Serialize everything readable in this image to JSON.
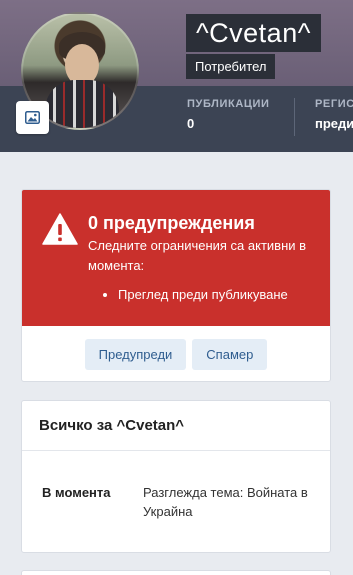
{
  "profile": {
    "username": "^Cvetan^",
    "user_title": "Потребител",
    "avatar_icon": "image-icon"
  },
  "stats": [
    {
      "label": "ПУБЛИКАЦИИ",
      "value": "0"
    },
    {
      "label": "РЕГИС",
      "value": "преди"
    }
  ],
  "warning": {
    "title": "0 предупреждения",
    "text": "Следните ограничения са активни в момента:",
    "restrictions": [
      "Преглед преди публикуване"
    ],
    "buttons": {
      "warn": "Предупреди",
      "spammer": "Спамер"
    },
    "color": "#c9302c"
  },
  "about": {
    "heading": "Всичко за ^Cvetan^",
    "rows": [
      {
        "key": "В момента",
        "value": "Разглежда тема: Войната в Украйна"
      }
    ]
  }
}
